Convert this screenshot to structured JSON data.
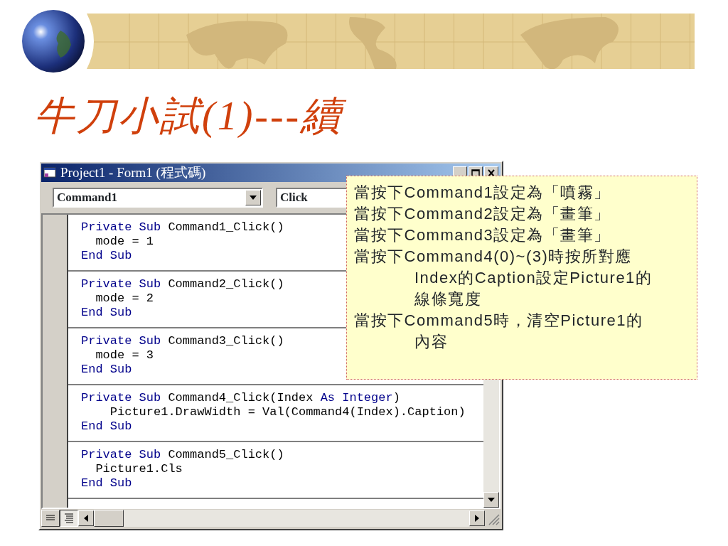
{
  "slide": {
    "title": "牛刀小試(1)---續"
  },
  "window": {
    "title": "Project1 - Form1 (程式碼)",
    "object_combo": "Command1",
    "procedure_combo": "Click",
    "view_buttons": [
      {
        "kind": "procedure",
        "selected": false
      },
      {
        "kind": "module",
        "selected": true
      }
    ],
    "procedures": [
      {
        "lines": [
          [
            {
              "text": "Private Sub",
              "kind": "keyword"
            },
            {
              "text": " Command1_Click()",
              "kind": "plain"
            }
          ],
          [
            {
              "text": "  mode = 1",
              "kind": "plain"
            }
          ],
          [
            {
              "text": "End Sub",
              "kind": "keyword"
            }
          ]
        ]
      },
      {
        "lines": [
          [
            {
              "text": "Private Sub",
              "kind": "keyword"
            },
            {
              "text": " Command2_Click()",
              "kind": "plain"
            }
          ],
          [
            {
              "text": "  mode = 2",
              "kind": "plain"
            }
          ],
          [
            {
              "text": "End Sub",
              "kind": "keyword"
            }
          ]
        ]
      },
      {
        "lines": [
          [
            {
              "text": "Private Sub",
              "kind": "keyword"
            },
            {
              "text": " Command3_Click()",
              "kind": "plain"
            }
          ],
          [
            {
              "text": "  mode = 3",
              "kind": "plain"
            }
          ],
          [
            {
              "text": "End Sub",
              "kind": "keyword"
            }
          ]
        ]
      },
      {
        "lines": [
          [
            {
              "text": "Private Sub",
              "kind": "keyword"
            },
            {
              "text": " Command4_Click(Index ",
              "kind": "plain"
            },
            {
              "text": "As Integer",
              "kind": "keyword"
            },
            {
              "text": ")",
              "kind": "plain"
            }
          ],
          [
            {
              "text": "    Picture1.DrawWidth = Val(Command4(Index).Caption)",
              "kind": "plain"
            }
          ],
          [
            {
              "text": "End Sub",
              "kind": "keyword"
            }
          ]
        ]
      },
      {
        "lines": [
          [
            {
              "text": "Private Sub",
              "kind": "keyword"
            },
            {
              "text": " Command5_Click()",
              "kind": "plain"
            }
          ],
          [
            {
              "text": "  Picture1.Cls",
              "kind": "plain"
            }
          ],
          [
            {
              "text": "End Sub",
              "kind": "keyword"
            }
          ]
        ]
      }
    ]
  },
  "callout": {
    "paragraphs": [
      {
        "lines": [
          "當按下Command1設定為「噴霧」"
        ]
      },
      {
        "lines": [
          "當按下Command2設定為「畫筆」"
        ]
      },
      {
        "lines": [
          "當按下Command3設定為「畫筆」"
        ]
      },
      {
        "lines": [
          "當按下Command4(0)~(3)時按所對應",
          "Index的Caption設定Picture1的",
          "線條寬度"
        ]
      },
      {
        "lines": [
          "當按下Command5時，清空Picture1的",
          "內容"
        ]
      }
    ]
  }
}
